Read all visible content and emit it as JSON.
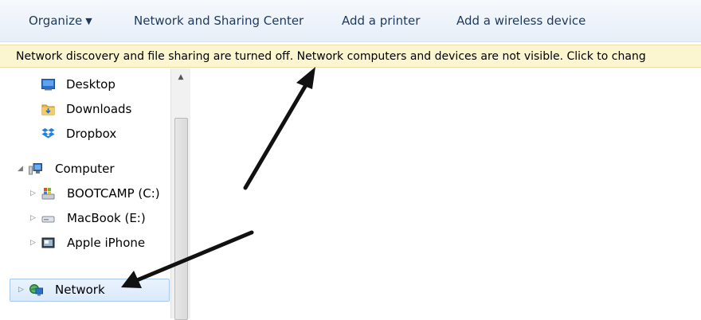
{
  "toolbar": {
    "organize_label": "Organize",
    "network_center_label": "Network and Sharing Center",
    "add_printer_label": "Add a printer",
    "add_wireless_label": "Add a wireless device"
  },
  "infobar": {
    "message": "Network discovery and file sharing are turned off. Network computers and devices are not visible. Click to chang"
  },
  "nav": {
    "desktop": "Desktop",
    "downloads": "Downloads",
    "dropbox": "Dropbox",
    "computer": "Computer",
    "bootcamp": "BOOTCAMP (C:)",
    "macbook": "MacBook (E:)",
    "iphone": "Apple iPhone",
    "network": "Network"
  },
  "colors": {
    "infobar_bg": "#fcf6d0",
    "toolbar_text": "#1e395b",
    "selection_border": "#a8c8ee",
    "annotation_arrow": "#111111"
  }
}
